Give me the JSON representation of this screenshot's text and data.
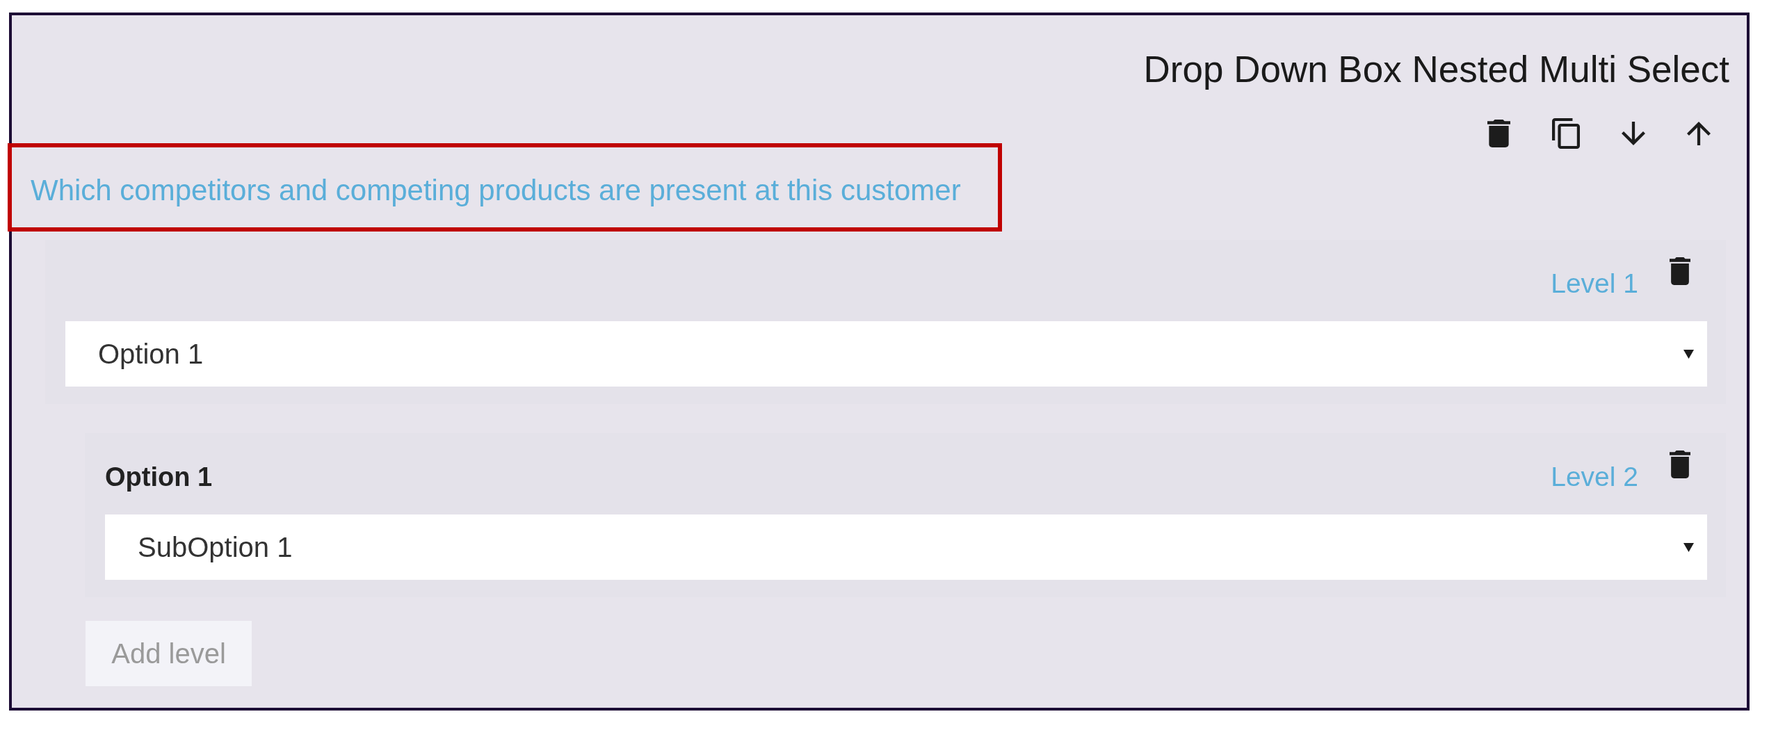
{
  "card": {
    "title": "Drop Down Box Nested Multi Select",
    "question": {
      "text": "Which competitors and competing products are present at this customer",
      "highlighted": true
    },
    "levels": [
      {
        "label": "Level 1",
        "dropdown": {
          "value": "Option 1"
        },
        "children": [
          {
            "heading": "Option 1",
            "label": "Level 2",
            "dropdown": {
              "value": "SubOption 1"
            }
          }
        ]
      }
    ],
    "add_button": {
      "label": "Add level",
      "disabled": true
    }
  }
}
